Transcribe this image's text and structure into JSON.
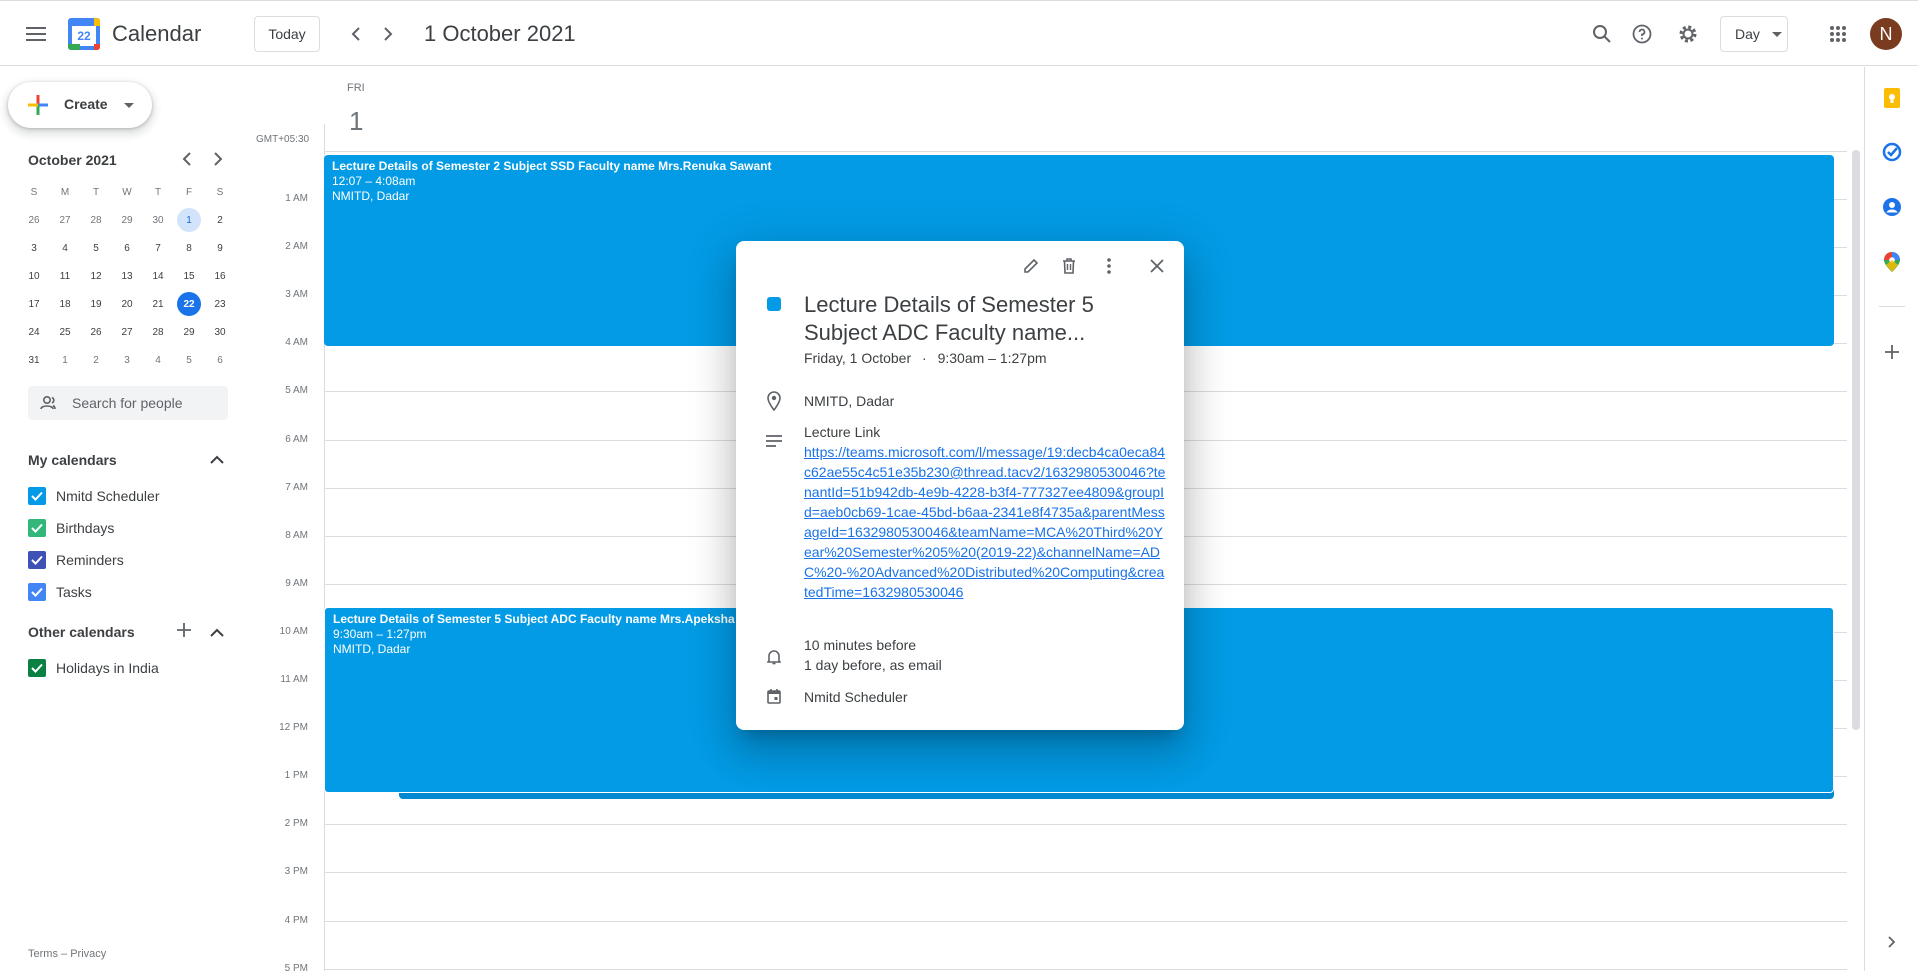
{
  "header": {
    "app_title": "Calendar",
    "logo_day": "22",
    "today_label": "Today",
    "date_title": "1 October 2021",
    "view_label": "Day",
    "avatar_initial": "N"
  },
  "sidebar": {
    "create_label": "Create",
    "mini_cal": {
      "title": "October 2021",
      "weekdays": [
        "S",
        "M",
        "T",
        "W",
        "T",
        "F",
        "S"
      ],
      "weeks": [
        [
          "26",
          "27",
          "28",
          "29",
          "30",
          "1",
          "2"
        ],
        [
          "3",
          "4",
          "5",
          "6",
          "7",
          "8",
          "9"
        ],
        [
          "10",
          "11",
          "12",
          "13",
          "14",
          "15",
          "16"
        ],
        [
          "17",
          "18",
          "19",
          "20",
          "21",
          "22",
          "23"
        ],
        [
          "24",
          "25",
          "26",
          "27",
          "28",
          "29",
          "30"
        ],
        [
          "31",
          "1",
          "2",
          "3",
          "4",
          "5",
          "6"
        ]
      ]
    },
    "search_people_placeholder": "Search for people",
    "my_calendars_title": "My calendars",
    "my_calendars": [
      {
        "label": "Nmitd Scheduler",
        "color": "#039be5"
      },
      {
        "label": "Birthdays",
        "color": "#33b679"
      },
      {
        "label": "Reminders",
        "color": "#3f51b5"
      },
      {
        "label": "Tasks",
        "color": "#4285f4"
      }
    ],
    "other_calendars_title": "Other calendars",
    "other_calendars": [
      {
        "label": "Holidays in India",
        "color": "#0b8043"
      }
    ],
    "footer_terms": "Terms",
    "footer_sep": " – ",
    "footer_privacy": "Privacy"
  },
  "day_view": {
    "weekday": "FRI",
    "day_number": "1",
    "timezone": "GMT+05:30",
    "hours": [
      "1 AM",
      "2 AM",
      "3 AM",
      "4 AM",
      "5 AM",
      "6 AM",
      "7 AM",
      "8 AM",
      "9 AM",
      "10 AM",
      "11 AM",
      "12 PM",
      "1 PM",
      "2 PM",
      "3 PM",
      "4 PM",
      "5 PM"
    ],
    "events": [
      {
        "title": "Lecture Details of Semester 2 Subject SSD Faculty name Mrs.Renuka Sawant",
        "time": "12:07 – 4:08am",
        "location": "NMITD, Dadar"
      },
      {
        "title": "Lecture Details of Semester 5 Subject ADC Faculty name Mrs.Apeksha Ga",
        "time": "9:30am – 1:27pm",
        "location": "NMITD, Dadar"
      }
    ]
  },
  "popup": {
    "title": "Lecture Details of Semester 5 Subject ADC Faculty name...",
    "date": "Friday, 1 October",
    "dot": "·",
    "time": "9:30am – 1:27pm",
    "location": "NMITD, Dadar",
    "desc_label": "Lecture Link",
    "link": "https://teams.microsoft.com/l/message/19:decb4ca0eca84c62ae55c4c51e35b230@thread.tacv2/1632980530046?tenantId=51b942db-4e9b-4228-b3f4-777327ee4809&groupId=aeb0cb69-1cae-45bd-b6aa-2341e8f4735a&parentMessageId=1632980530046&teamName=MCA%20Third%20Year%20Semester%205%20(2019-22)&channelName=ADC%20-%20Advanced%20Distributed%20Computing&createdTime=1632980530046",
    "reminder_1": "10 minutes before",
    "reminder_2": "1 day before, as email",
    "calendar": "Nmitd Scheduler",
    "color": "#039be5"
  }
}
